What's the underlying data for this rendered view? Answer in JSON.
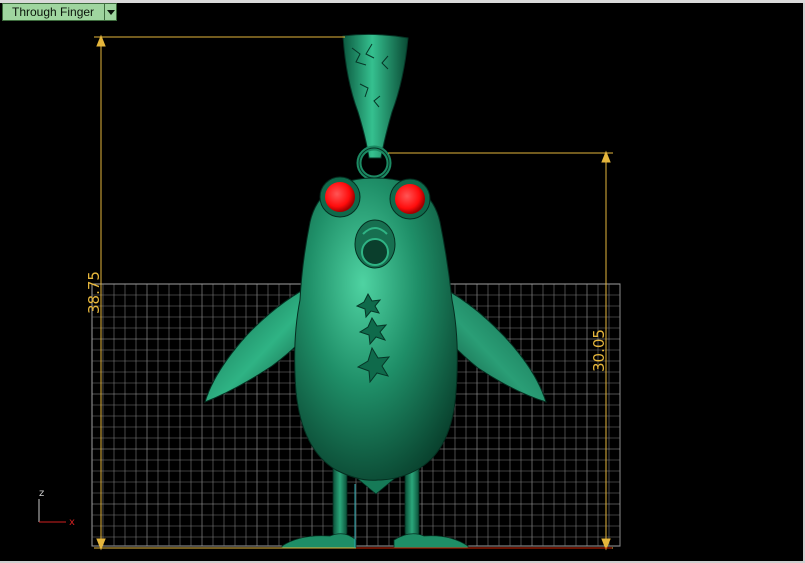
{
  "viewport": {
    "label": "Through Finger",
    "label_bg": "#9fd59f"
  },
  "dimensions": {
    "overall_height": "38.75",
    "body_height": "30.05",
    "color": "#e5b63c"
  },
  "axes": {
    "z_label": "z",
    "x_label": "x"
  },
  "model": {
    "material_color": "#1f8f68",
    "eye_color": "#ff1a1a",
    "grid_color": "#9a9a9a"
  },
  "icons": {
    "dropdown": "chevron-down-icon"
  }
}
